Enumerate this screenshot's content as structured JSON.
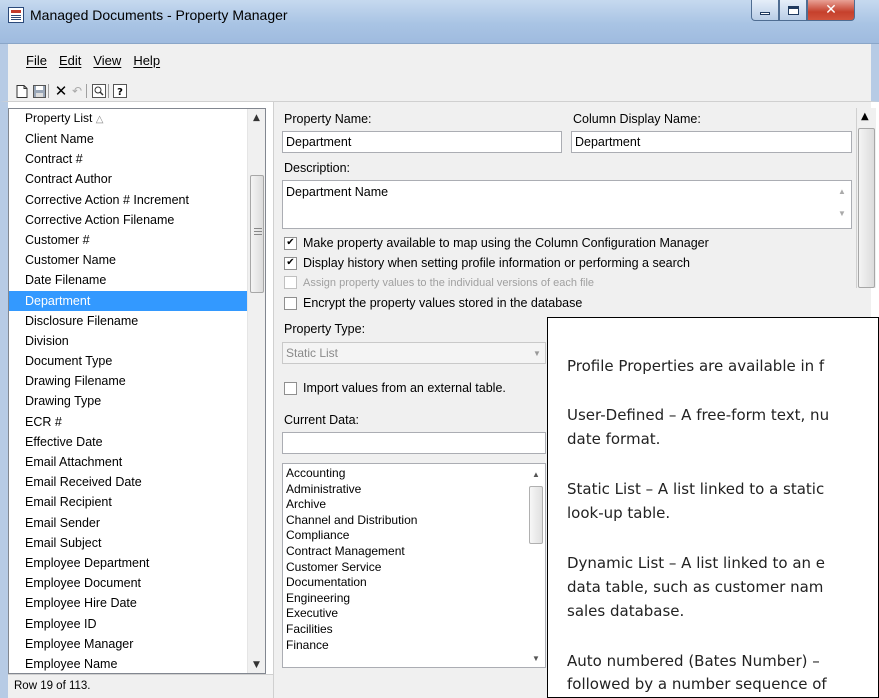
{
  "window": {
    "title": "Managed Documents - Property Manager"
  },
  "menu": {
    "file": "File",
    "edit": "Edit",
    "view": "View",
    "help": "Help"
  },
  "property_list": {
    "header": "Property List",
    "sort_indicator": "△",
    "selected_index": 9,
    "items": [
      "Client Name",
      "Contract #",
      "Contract Author",
      "Corrective Action # Increment",
      "Corrective Action Filename",
      "Customer #",
      "Customer Name",
      "Date Filename",
      "Department",
      "Disclosure Filename",
      "Division",
      "Document Type",
      "Drawing Filename",
      "Drawing Type",
      "ECR #",
      "Effective Date",
      "Email Attachment",
      "Email Received Date",
      "Email Recipient",
      "Email Sender",
      "Email Subject",
      "Employee Department",
      "Employee Document",
      "Employee Hire Date",
      "Employee ID",
      "Employee Manager",
      "Employee Name"
    ]
  },
  "status": {
    "text": "Row 19 of 113."
  },
  "detail": {
    "property_name_label": "Property Name:",
    "property_name_value": "Department",
    "column_display_label": "Column Display Name:",
    "column_display_value": "Department",
    "description_label": "Description:",
    "description_value": "Department Name",
    "options": [
      {
        "label": "Make property available to map using the Column Configuration Manager",
        "checked": true,
        "enabled": true
      },
      {
        "label": "Display history when setting profile information or performing a search",
        "checked": true,
        "enabled": true
      },
      {
        "label": "Assign property values to the individual versions of each file",
        "checked": false,
        "enabled": false
      },
      {
        "label": "Encrypt the property values stored in the database",
        "checked": false,
        "enabled": true
      }
    ],
    "property_type_label": "Property Type:",
    "property_type_value": "Static List",
    "import_label": "Import values from an external table.",
    "current_data_label": "Current Data:",
    "current_data_value": "",
    "data_items": [
      "Accounting",
      "Administrative",
      "Archive",
      "Channel and Distribution",
      "Compliance",
      "Contract Management",
      "Customer Service",
      "Documentation",
      "Engineering",
      "Executive",
      "Facilities",
      "Finance"
    ]
  },
  "help_popup": {
    "line1": "Profile Properties are available in f",
    "line2a": "User-Defined – A free-form text, nu",
    "line2b": "date format.",
    "line3a": "Static List – A list linked to a static",
    "line3b": "look-up table.",
    "line4a": "Dynamic List – A list linked to an e",
    "line4b": "data table, such as customer nam",
    "line4c": "sales database.",
    "line5a": "Auto numbered (Bates Number) –",
    "line5b": "followed by a number sequence of"
  }
}
